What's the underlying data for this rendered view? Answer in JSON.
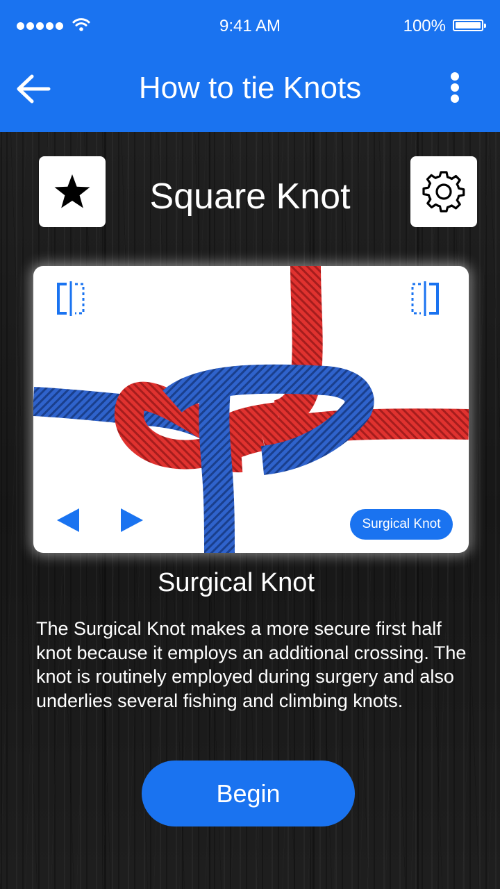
{
  "status_bar": {
    "time": "9:41 AM",
    "battery": "100%"
  },
  "header": {
    "title": "How to tie Knots",
    "back_icon": "arrow-left-icon",
    "menu_icon": "more-vertical-icon"
  },
  "knot": {
    "name": "Square Knot",
    "favorite_icon": "star-icon",
    "settings_icon": "gear-icon"
  },
  "viewer": {
    "flip_left_icon": "flip-horizontal-icon",
    "flip_right_icon": "flip-horizontal-icon",
    "prev_icon": "triangle-left-icon",
    "next_icon": "triangle-right-icon",
    "variant_chip": "Surgical Knot"
  },
  "variant": {
    "title": "Surgical Knot",
    "description": "The Surgical Knot makes a more secure first half knot because it employs an additional crossing. The knot is routinely employed during surgery and also underlies several fishing and climbing knots."
  },
  "action": {
    "begin_label": "Begin"
  },
  "colors": {
    "accent": "#1a73f0",
    "rope_red": "#e0322f",
    "rope_blue": "#2454b8"
  }
}
